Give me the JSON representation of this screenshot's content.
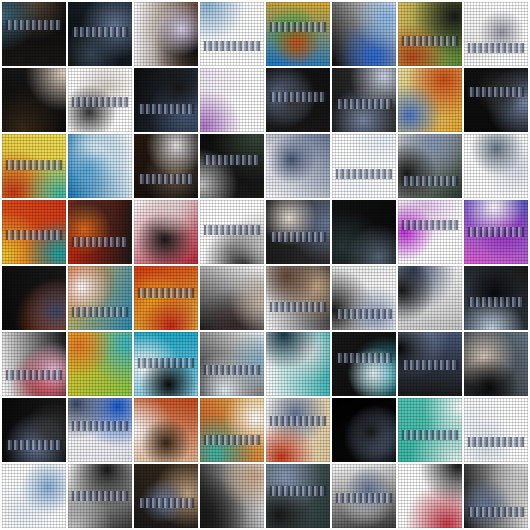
{
  "grid": {
    "rows": 8,
    "cols": 8,
    "description_note": "",
    "tiles": [
      {
        "c": [
          "#1a1816",
          "#5a4a3a",
          "#3e6b7c",
          "#0a0a0a"
        ]
      },
      {
        "c": [
          "#0d0d0d",
          "#6a7b9a",
          "#3a4a5a",
          "#1a2a35"
        ]
      },
      {
        "c": [
          "#ffffff",
          "#111111",
          "#d9d2ee",
          "#5a3a2a"
        ]
      },
      {
        "c": [
          "#ffffff",
          "#eef4fa",
          "#8fb8d8",
          "#ffffff"
        ]
      },
      {
        "c": [
          "#e0b030",
          "#3aa84a",
          "#c8501a",
          "#1a7acb"
        ]
      },
      {
        "c": [
          "#ffffff",
          "#2a6ad8",
          "#88b8e8",
          "#0a0a0a"
        ]
      },
      {
        "c": [
          "#5a8a3a",
          "#1a1a1a",
          "#b84a1a",
          "#e0c060"
        ]
      },
      {
        "c": [
          "#ffffff",
          "#eeeeee",
          "#9a9aa8",
          "#ffffff"
        ]
      },
      {
        "c": [
          "#0a0a0a",
          "#3a2a1a",
          "#e8d8c8",
          "#1a1a1a"
        ]
      },
      {
        "c": [
          "#ffffff",
          "#d8d0c8",
          "#3a3a3a",
          "#ffffff"
        ]
      },
      {
        "c": [
          "#0d0d0d",
          "#4a5a7a",
          "#1a1a1a",
          "#2a3a4a"
        ]
      },
      {
        "c": [
          "#ffffff",
          "#f0e8f4",
          "#b078c8",
          "#ffffff"
        ]
      },
      {
        "c": [
          "#111111",
          "#6a7a9a",
          "#3a3a3a",
          "#1a1a1a"
        ]
      },
      {
        "c": [
          "#3a3a3a",
          "#7a8aa8",
          "#cfd8e8",
          "#1a1a1a"
        ]
      },
      {
        "c": [
          "#e8a830",
          "#d05018",
          "#4a78c8",
          "#e8e0a0"
        ]
      },
      {
        "c": [
          "#0a0a0a",
          "#7a8aa8",
          "#303030",
          "#111111"
        ]
      },
      {
        "c": [
          "#e8c030",
          "#c83a1a",
          "#3ab8a8",
          "#f0e058"
        ]
      },
      {
        "c": [
          "#1a7ab8",
          "#e8f4fa",
          "#58a8d8",
          "#ffffff"
        ]
      },
      {
        "c": [
          "#2a1a10",
          "#6a5a4a",
          "#e8e8e8",
          "#0a0a0a"
        ]
      },
      {
        "c": [
          "#0d0d0d",
          "#3a4a3a",
          "#c8c8c8",
          "#1a1a1a"
        ]
      },
      {
        "c": [
          "#6a7a9a",
          "#e8e8f0",
          "#4a5a7a",
          "#ffffff"
        ]
      },
      {
        "c": [
          "#ffffff",
          "#f4f8fc",
          "#e8f0f8",
          "#ffffff"
        ]
      },
      {
        "c": [
          "#2a3a30",
          "#8898b8",
          "#1a1a1a",
          "#d0d0d0"
        ]
      },
      {
        "c": [
          "#ffffff",
          "#d8dce8",
          "#6a7a8a",
          "#ffffff"
        ]
      },
      {
        "c": [
          "#e85a18",
          "#f0c830",
          "#18a8a8",
          "#d03818"
        ]
      },
      {
        "c": [
          "#c82a10",
          "#2a2a2a",
          "#e86a1a",
          "#1a1a1a"
        ]
      },
      {
        "c": [
          "#ffffff",
          "#1a1a1a",
          "#e8d8d8",
          "#b8283a"
        ]
      },
      {
        "c": [
          "#ffffff",
          "#1a1a1a",
          "#c8c8c8",
          "#ffffff"
        ]
      },
      {
        "c": [
          "#3a3a3a",
          "#6a7a9a",
          "#e8e0d8",
          "#1a1a1a"
        ]
      },
      {
        "c": [
          "#0a0a0a",
          "#2a3a3a",
          "#5a6a7a",
          "#111111"
        ]
      },
      {
        "c": [
          "#ffffff",
          "#e8c8f0",
          "#c030d8",
          "#ffffff"
        ]
      },
      {
        "c": [
          "#e060d8",
          "#a030c8",
          "#ffffff",
          "#5a58c8"
        ]
      },
      {
        "c": [
          "#0a0a0a",
          "#c84a1a",
          "#3a4a6a",
          "#1a1a1a"
        ]
      },
      {
        "c": [
          "#e8c058",
          "#c84a1a",
          "#ffffff",
          "#2a8ab8"
        ]
      },
      {
        "c": [
          "#d83a10",
          "#f0a020",
          "#c82818",
          "#e8c040"
        ]
      },
      {
        "c": [
          "#ffffff",
          "#3a2a2a",
          "#c8b8a8",
          "#1a1a1a"
        ]
      },
      {
        "c": [
          "#1a1a1a",
          "#c8a888",
          "#6a4a3a",
          "#ffffff"
        ]
      },
      {
        "c": [
          "#ffffff",
          "#1a1a1a",
          "#8a9ab8",
          "#e8e8e8"
        ]
      },
      {
        "c": [
          "#c8c8c8",
          "#3a4a6a",
          "#1a1a1a",
          "#ffffff"
        ]
      },
      {
        "c": [
          "#3a4a5a",
          "#0a0a0a",
          "#c8d8e8",
          "#1a1a1a"
        ]
      },
      {
        "c": [
          "#ffffff",
          "#c82a3a",
          "#e8c0d8",
          "#1a1a1a"
        ]
      },
      {
        "c": [
          "#f0c828",
          "#3ab8c8",
          "#e87a28",
          "#88c848"
        ]
      },
      {
        "c": [
          "#18a8c8",
          "#ffffff",
          "#0a0a0a",
          "#88d0e8"
        ]
      },
      {
        "c": [
          "#ffffff",
          "#e8f0f4",
          "#8ab0c8",
          "#1a1a1a"
        ]
      },
      {
        "c": [
          "#3ab8b8",
          "#e8e8e8",
          "#1a3a4a",
          "#ffffff"
        ]
      },
      {
        "c": [
          "#0a0a0a",
          "#3ab8c8",
          "#e8f0f4",
          "#1a1a1a"
        ]
      },
      {
        "c": [
          "#1a1a1a",
          "#8a9ab8",
          "#0a0a0a",
          "#4a5a7a"
        ]
      },
      {
        "c": [
          "#2a2a2a",
          "#d8c8b8",
          "#0a0a0a",
          "#6a7a8a"
        ]
      },
      {
        "c": [
          "#0a0a0a",
          "#6a7a9a",
          "#3a3a3a",
          "#1a1a1a"
        ]
      },
      {
        "c": [
          "#ffffff",
          "#1a58c8",
          "#3a4a6a",
          "#e8e8f0"
        ]
      },
      {
        "c": [
          "#c84a1a",
          "#ffffff",
          "#3a2a1a",
          "#e8c8a8"
        ]
      },
      {
        "c": [
          "#e8c058",
          "#3ab8a8",
          "#ffffff",
          "#c84a1a"
        ]
      },
      {
        "c": [
          "#e0c898",
          "#6a7a9a",
          "#c83a1a",
          "#ffffff"
        ]
      },
      {
        "c": [
          "#0a0a0a",
          "#6a7a9a",
          "#1a1a1a",
          "#000000"
        ]
      },
      {
        "c": [
          "#3ab8a8",
          "#e8f4f0",
          "#ffffff",
          "#58c8b8"
        ]
      },
      {
        "c": [
          "#ffffff",
          "#f0f4f8",
          "#d8e0e8",
          "#ffffff"
        ]
      },
      {
        "c": [
          "#ffffff",
          "#e8f0f8",
          "#8ab0d8",
          "#ffffff"
        ]
      },
      {
        "c": [
          "#ffffff",
          "#1a1a1a",
          "#c8c8c8",
          "#3a3a3a"
        ]
      },
      {
        "c": [
          "#3a2a1a",
          "#c8a888",
          "#6a7a9a",
          "#1a1a1a"
        ]
      },
      {
        "c": [
          "#ffffff",
          "#1a1a1a",
          "#c8a888",
          "#0a0a0a"
        ]
      },
      {
        "c": [
          "#2a3a3a",
          "#8a9ab8",
          "#1a1a1a",
          "#5a6a6a"
        ]
      },
      {
        "c": [
          "#3a3a3a",
          "#c8c8c8",
          "#6a7a9a",
          "#ffffff"
        ]
      },
      {
        "c": [
          "#ffffff",
          "#c83a4a",
          "#1a1a1a",
          "#ffffff"
        ]
      },
      {
        "c": [
          "#1a1a1a",
          "#c8c8c8",
          "#6a7a9a",
          "#ffffff"
        ]
      }
    ]
  }
}
